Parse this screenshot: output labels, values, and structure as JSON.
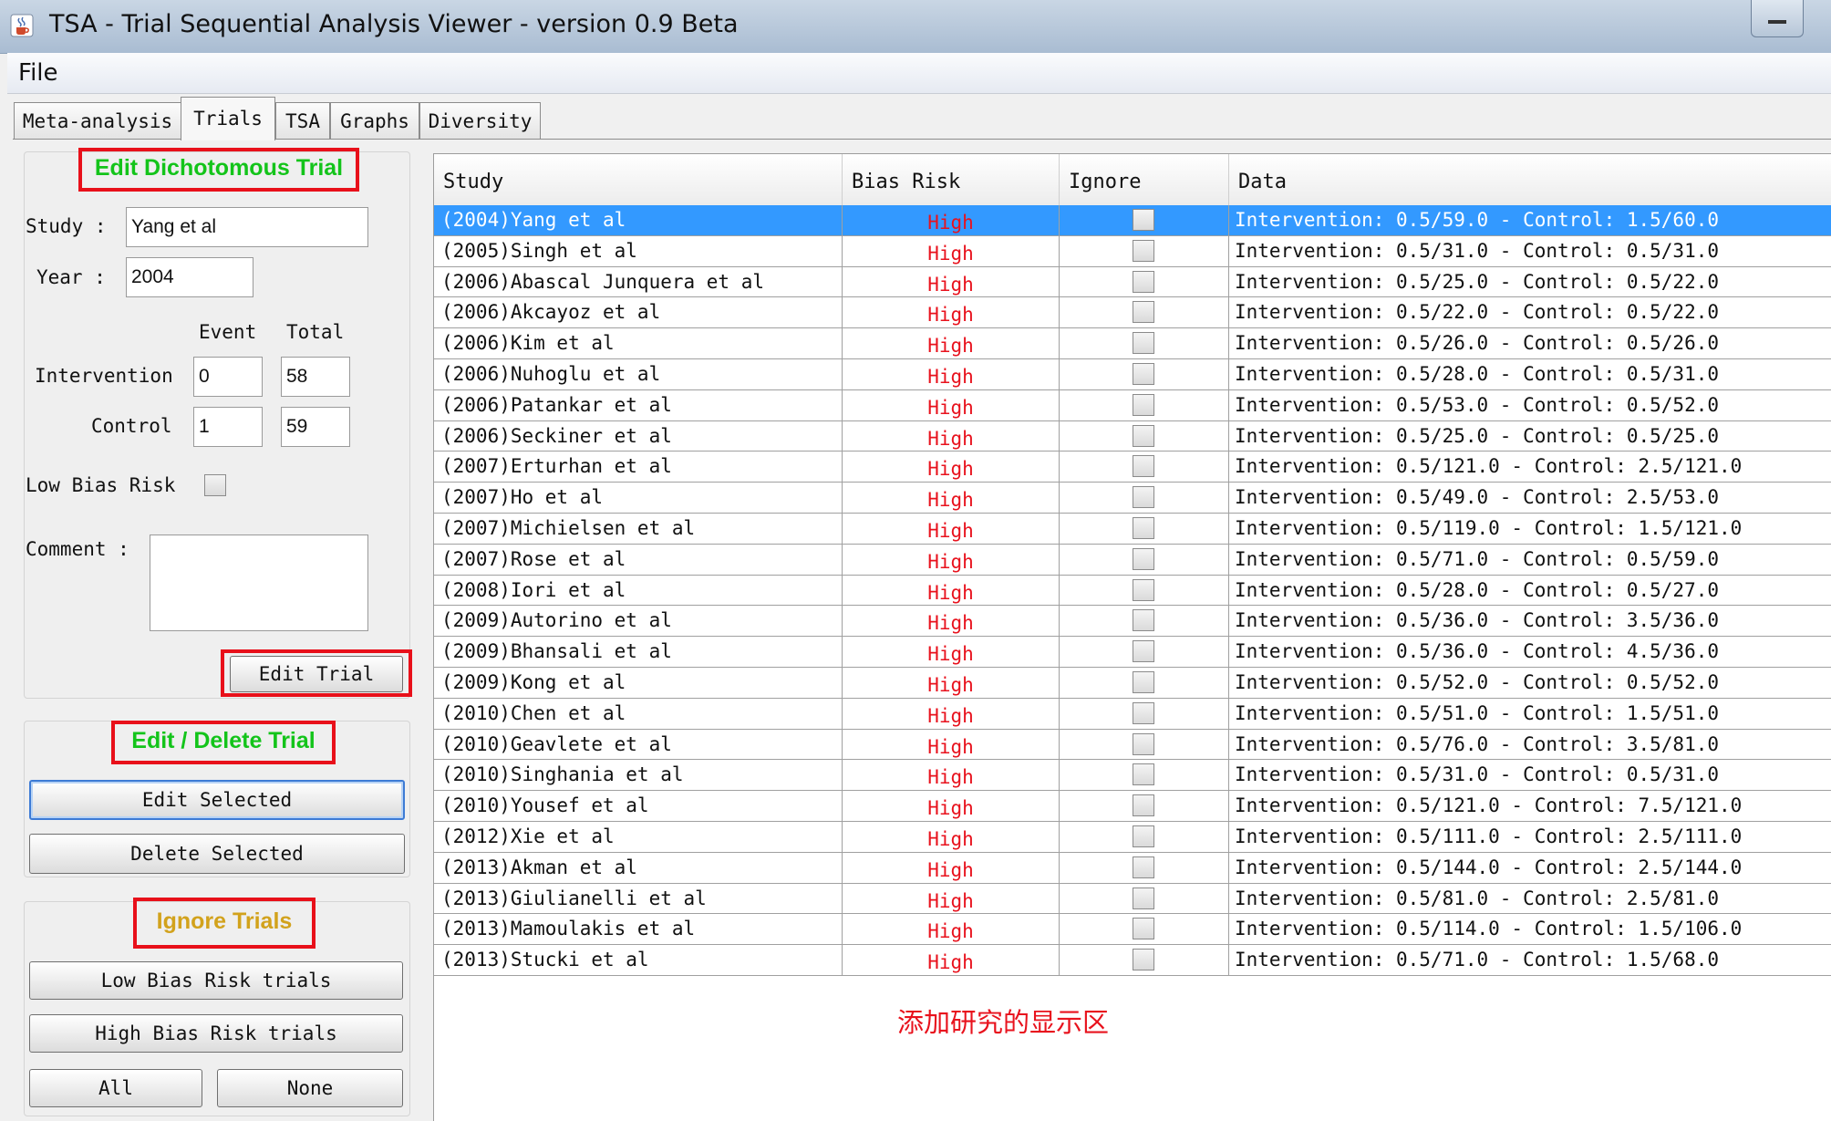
{
  "window": {
    "title": "TSA - Trial Sequential Analysis Viewer - version 0.9 Beta",
    "icon": "java-coffee-icon"
  },
  "menu": {
    "file": "File"
  },
  "tabs": [
    {
      "label": "Meta-analysis",
      "active": false
    },
    {
      "label": "Trials",
      "active": true
    },
    {
      "label": "TSA",
      "active": false
    },
    {
      "label": "Graphs",
      "active": false
    },
    {
      "label": "Diversity",
      "active": false
    }
  ],
  "edit_trial": {
    "title": "Edit Dichotomous Trial",
    "study_label": "Study :",
    "study_value": "Yang et al",
    "year_label": "Year :",
    "year_value": "2004",
    "event_header": "Event",
    "total_header": "Total",
    "intervention_label": "Intervention",
    "intervention_event": "0",
    "intervention_total": "58",
    "control_label": "Control",
    "control_event": "1",
    "control_total": "59",
    "low_bias_label": "Low Bias Risk",
    "comment_label": "Comment :",
    "edit_button": "Edit Trial"
  },
  "edit_delete": {
    "title": "Edit / Delete Trial",
    "edit_selected": "Edit Selected",
    "delete_selected": "Delete Selected"
  },
  "ignore": {
    "title": "Ignore Trials",
    "low_bias": "Low Bias Risk trials",
    "high_bias": "High Bias Risk trials",
    "all": "All",
    "none": "None"
  },
  "table": {
    "headers": [
      "Study",
      "Bias Risk",
      "Ignore",
      "Data"
    ],
    "rows": [
      {
        "study": "(2004)Yang et al",
        "bias": "High",
        "data": "Intervention: 0.5/59.0 - Control: 1.5/60.0"
      },
      {
        "study": "(2005)Singh et al",
        "bias": "High",
        "data": "Intervention: 0.5/31.0 - Control: 0.5/31.0"
      },
      {
        "study": "(2006)Abascal Junquera et al",
        "bias": "High",
        "data": "Intervention: 0.5/25.0 - Control: 0.5/22.0"
      },
      {
        "study": "(2006)Akcayoz et al",
        "bias": "High",
        "data": "Intervention: 0.5/22.0 - Control: 0.5/22.0"
      },
      {
        "study": "(2006)Kim et al",
        "bias": "High",
        "data": "Intervention: 0.5/26.0 - Control: 0.5/26.0"
      },
      {
        "study": "(2006)Nuhoglu et al",
        "bias": "High",
        "data": "Intervention: 0.5/28.0 - Control: 0.5/31.0"
      },
      {
        "study": "(2006)Patankar et al",
        "bias": "High",
        "data": "Intervention: 0.5/53.0 - Control: 0.5/52.0"
      },
      {
        "study": "(2006)Seckiner et al",
        "bias": "High",
        "data": "Intervention: 0.5/25.0 - Control: 0.5/25.0"
      },
      {
        "study": "(2007)Erturhan et al",
        "bias": "High",
        "data": "Intervention: 0.5/121.0 - Control: 2.5/121.0"
      },
      {
        "study": "(2007)Ho et al",
        "bias": "High",
        "data": "Intervention: 0.5/49.0 - Control: 2.5/53.0"
      },
      {
        "study": "(2007)Michielsen et al",
        "bias": "High",
        "data": "Intervention: 0.5/119.0 - Control: 1.5/121.0"
      },
      {
        "study": "(2007)Rose et al",
        "bias": "High",
        "data": "Intervention: 0.5/71.0 - Control: 0.5/59.0"
      },
      {
        "study": "(2008)Iori et al",
        "bias": "High",
        "data": "Intervention: 0.5/28.0 - Control: 0.5/27.0"
      },
      {
        "study": "(2009)Autorino et al",
        "bias": "High",
        "data": "Intervention: 0.5/36.0 - Control: 3.5/36.0"
      },
      {
        "study": "(2009)Bhansali et al",
        "bias": "High",
        "data": "Intervention: 0.5/36.0 - Control: 4.5/36.0"
      },
      {
        "study": "(2009)Kong et al",
        "bias": "High",
        "data": "Intervention: 0.5/52.0 - Control: 0.5/52.0"
      },
      {
        "study": "(2010)Chen et al",
        "bias": "High",
        "data": "Intervention: 0.5/51.0 - Control: 1.5/51.0"
      },
      {
        "study": "(2010)Geavlete et al",
        "bias": "High",
        "data": "Intervention: 0.5/76.0 - Control: 3.5/81.0"
      },
      {
        "study": "(2010)Singhania et al",
        "bias": "High",
        "data": "Intervention: 0.5/31.0 - Control: 0.5/31.0"
      },
      {
        "study": "(2010)Yousef et al",
        "bias": "High",
        "data": "Intervention: 0.5/121.0 - Control: 7.5/121.0"
      },
      {
        "study": "(2012)Xie et al",
        "bias": "High",
        "data": "Intervention: 0.5/111.0 - Control: 2.5/111.0"
      },
      {
        "study": "(2013)Akman et al",
        "bias": "High",
        "data": "Intervention: 0.5/144.0 - Control: 2.5/144.0"
      },
      {
        "study": "(2013)Giulianelli et al",
        "bias": "High",
        "data": "Intervention: 0.5/81.0 - Control: 2.5/81.0"
      },
      {
        "study": "(2013)Mamoulakis et al",
        "bias": "High",
        "data": "Intervention: 0.5/114.0 - Control: 1.5/106.0"
      },
      {
        "study": "(2013)Stucki et al",
        "bias": "High",
        "data": "Intervention: 0.5/71.0 - Control: 1.5/68.0"
      }
    ],
    "selected_index": 0
  },
  "annotation": "添加研究的显示区",
  "colors": {
    "highlight_red": "#e8101a",
    "title_green": "#13c41a",
    "title_gold": "#d2a21c",
    "selection_blue": "#3399ff"
  }
}
